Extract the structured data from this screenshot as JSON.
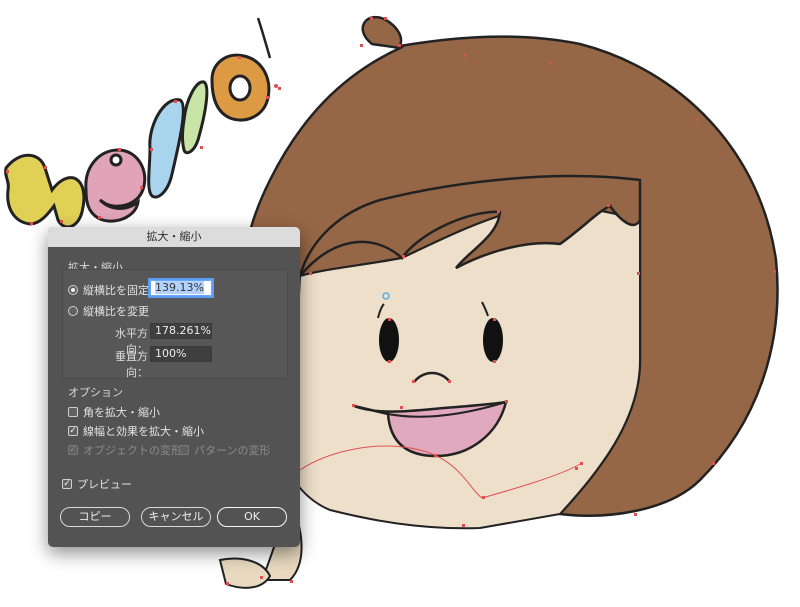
{
  "canvas": {
    "hello_text": "Hello!",
    "colors": {
      "hair": "#966746",
      "skin": "#eddfca",
      "mouth": "#e0a9bd",
      "letter_h": "#e1d056",
      "letter_e": "#e0a3b8",
      "letter_l1": "#a9d4ee",
      "letter_l2": "#c8e4a6",
      "letter_o": "#dd9a45",
      "anchor": "#e05050"
    }
  },
  "dialog": {
    "title": "拡大・縮小",
    "scale_section": "拡大・縮小",
    "uniform_label": "縦横比を固定：",
    "uniform_value": "139.13%",
    "uniform_selected": true,
    "nonuniform_label": "縦横比を変更",
    "horizontal_label": "水平方向：",
    "horizontal_value": "178.261%",
    "vertical_label": "垂直方向：",
    "vertical_value": "100%",
    "options_section": "オプション",
    "scale_corners_label": "角を拡大・縮小",
    "scale_corners_checked": false,
    "scale_strokes_label": "線幅と効果を拡大・縮小",
    "scale_strokes_checked": true,
    "transform_objects_label": "オブジェクトの変形",
    "transform_patterns_label": "パターンの変形",
    "preview_label": "プレビュー",
    "preview_checked": true,
    "copy_button": "コピー",
    "cancel_button": "キャンセル",
    "ok_button": "OK"
  }
}
